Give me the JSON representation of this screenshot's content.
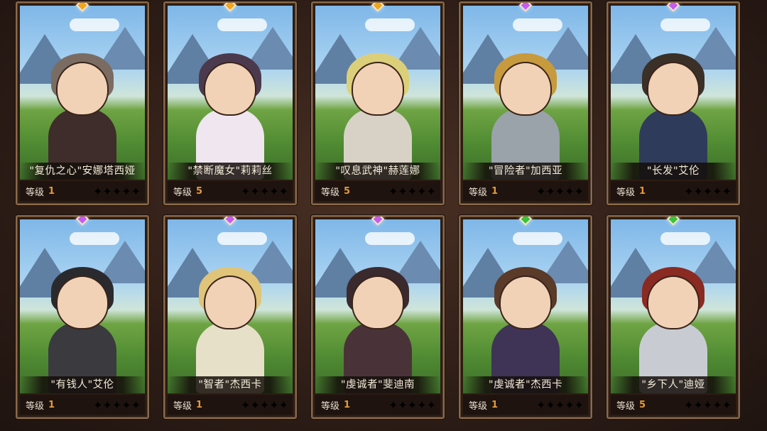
{
  "heroes": [
    {
      "name": "\"复仇之心\"安娜塔西娅",
      "level_label": "等级",
      "level": "1",
      "gem": "#f0a51e",
      "hair": "#7a6c62",
      "body": "#3e2d2a",
      "stars": "✦✦✦✦✦"
    },
    {
      "name": "\"禁断魔女\"莉莉丝",
      "level_label": "等级",
      "level": "5",
      "gem": "#f0a51e",
      "hair": "#4b3a4e",
      "body": "#efe6ef",
      "stars": "✦✦✦✦✦"
    },
    {
      "name": "\"叹息武神\"赫莲娜",
      "level_label": "等级",
      "level": "5",
      "gem": "#f0a51e",
      "hair": "#dccf7a",
      "body": "#d8d2c6",
      "stars": "✦✦✦✦✦"
    },
    {
      "name": "\"冒险者\"加西亚",
      "level_label": "等级",
      "level": "1",
      "gem": "#c45cf0",
      "hair": "#c79a3e",
      "body": "#9aa2aa",
      "stars": "✦✦✦✦✦"
    },
    {
      "name": "\"长发\"艾伦",
      "level_label": "等级",
      "level": "1",
      "gem": "#c45cf0",
      "hair": "#3a3028",
      "body": "#2f3b5a",
      "stars": "✦✦✦✦✦"
    },
    {
      "name": "\"有钱人\"艾伦",
      "level_label": "等级",
      "level": "1",
      "gem": "#c45cf0",
      "hair": "#2a2a2e",
      "body": "#3a3a3f",
      "stars": "✦✦✦✦✦"
    },
    {
      "name": "\"智者\"杰西卡",
      "level_label": "等级",
      "level": "1",
      "gem": "#c45cf0",
      "hair": "#e0c47a",
      "body": "#e7e0c8",
      "stars": "✦✦✦✦✦"
    },
    {
      "name": "\"虔诚者\"斐迪南",
      "level_label": "等级",
      "level": "1",
      "gem": "#c45cf0",
      "hair": "#3a2a2e",
      "body": "#4a3338",
      "stars": "✦✦✦✦✦"
    },
    {
      "name": "\"虔诚者\"杰西卡",
      "level_label": "等级",
      "level": "1",
      "gem": "#3ac23a",
      "hair": "#5a3a28",
      "body": "#3f3356",
      "stars": "✦✦✦✦✦"
    },
    {
      "name": "\"乡下人\"迪娅",
      "level_label": "等级",
      "level": "5",
      "gem": "#3ac23a",
      "hair": "#8a2a22",
      "body": "#c8ccd2",
      "stars": "✦✦✦✦✦"
    }
  ]
}
